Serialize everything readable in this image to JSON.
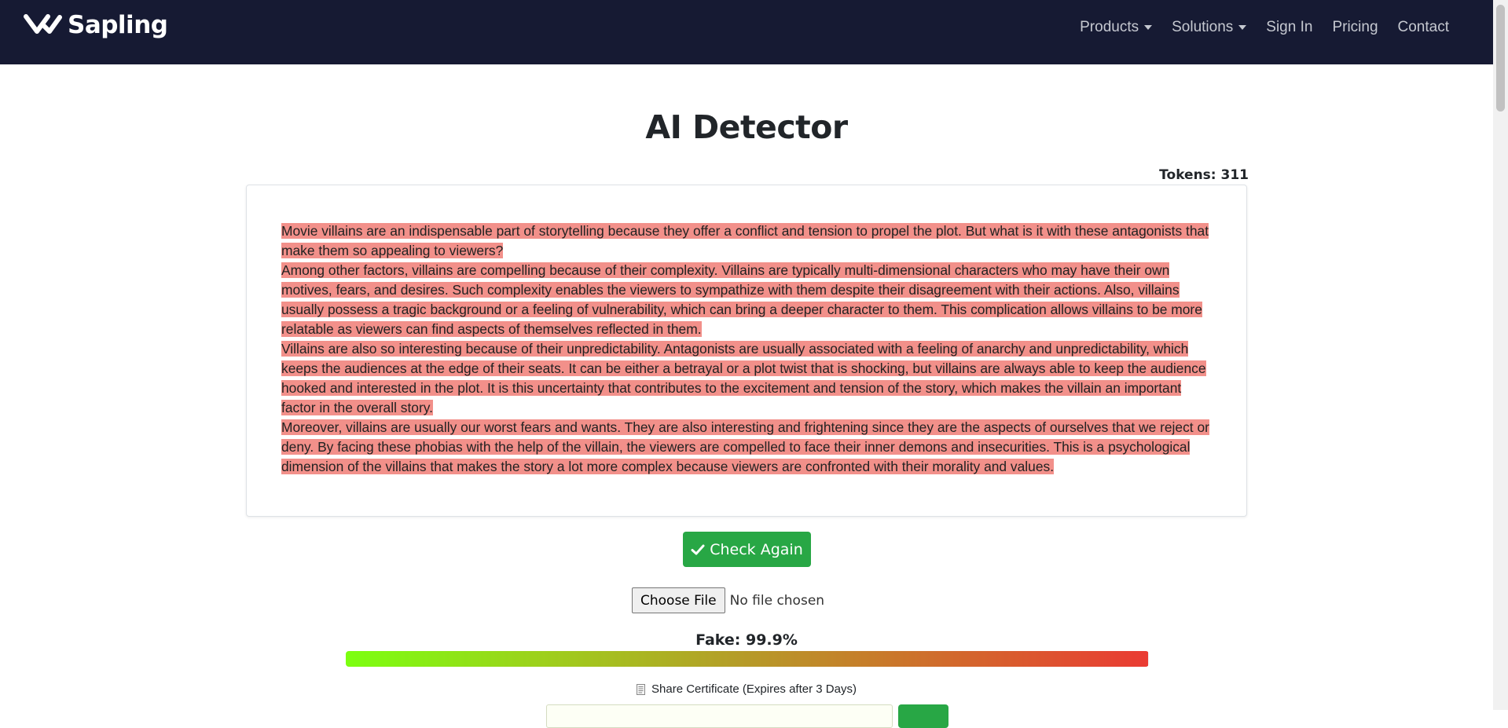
{
  "brand": {
    "name": "Sapling",
    "logo_icon": "sapling-v-logo-icon"
  },
  "nav": {
    "items": [
      {
        "label": "Products",
        "dropdown": true
      },
      {
        "label": "Solutions",
        "dropdown": true
      },
      {
        "label": "Sign In",
        "dropdown": false
      },
      {
        "label": "Pricing",
        "dropdown": false
      },
      {
        "label": "Contact",
        "dropdown": false
      }
    ]
  },
  "page": {
    "title": "AI Detector",
    "tokens": "Tokens: 311"
  },
  "text": {
    "paragraphs": [
      "Movie villains are an indispensable part of storytelling because they offer a conflict and tension to propel the plot. But what is it with these antagonists that make them so appealing to viewers?",
      "Among other factors, villains are compelling because of their complexity. Villains are typically multi-dimensional characters who may have their own motives, fears, and desires. Such complexity enables the viewers to sympathize with them despite their disagreement with their actions. Also, villains usually possess a tragic background or a feeling of vulnerability, which can bring a deeper character to them. This complication allows villains to be more relatable as viewers can find aspects of themselves reflected in them.",
      "Villains are also so interesting because of their unpredictability. Antagonists are usually associated with a feeling of anarchy and unpredictability, which keeps the audiences at the edge of their seats. It can be either a betrayal or a plot twist that is shocking, but villains are always able to keep the audience hooked and interested in the plot. It is this uncertainty that contributes to the excitement and tension of the story, which makes the villain an important factor in the overall story.",
      "Moreover, villains are usually our worst fears and wants. They are also interesting and frightening since they are the aspects of ourselves that we reject or deny. By facing these phobias with the help of the villain, the viewers are compelled to face their inner demons and insecurities. This is a psychological dimension of the villains that makes the story a lot more complex because viewers are confronted with their morality and values."
    ],
    "highlight_color": "#f2908a"
  },
  "actions": {
    "check_again_label": "Check Again",
    "check_icon": "check-icon",
    "choose_file_label": "Choose File",
    "file_status": "No file chosen"
  },
  "result": {
    "fake_label": "Fake: 99.9%",
    "fake_fraction": 0.999,
    "share_label": "Share Certificate (Expires after 3 Days)",
    "share_icon": "document-icon"
  },
  "colors": {
    "navbar": "#161a33",
    "accent_green": "#28a745",
    "meter_start": "#7cff10",
    "meter_end": "#ea3b33"
  }
}
